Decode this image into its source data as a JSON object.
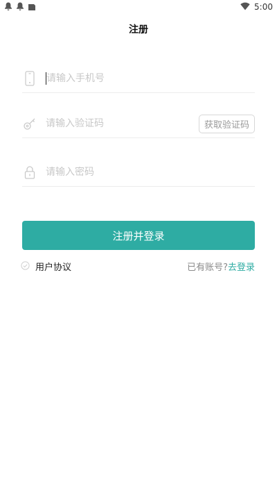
{
  "status_bar": {
    "time": "5:00",
    "icons": [
      "notification-icon",
      "notification-icon",
      "sim-icon",
      "wifi-icon"
    ]
  },
  "header": {
    "title": "注册"
  },
  "form": {
    "phone": {
      "placeholder": "请输入手机号",
      "value": "",
      "icon": "phone-icon"
    },
    "code": {
      "placeholder": "请输入验证码",
      "value": "",
      "icon": "key-icon",
      "button_label": "获取验证码"
    },
    "password": {
      "placeholder": "请输入密码",
      "value": "",
      "icon": "lock-icon"
    }
  },
  "actions": {
    "submit_label": "注册并登录",
    "agreement_label": "用户协议",
    "have_account_label": "已有账号?",
    "go_login_label": "去登录"
  },
  "colors": {
    "accent": "#2eaca3",
    "placeholder": "#c8c8c8",
    "divider": "#ececec"
  }
}
